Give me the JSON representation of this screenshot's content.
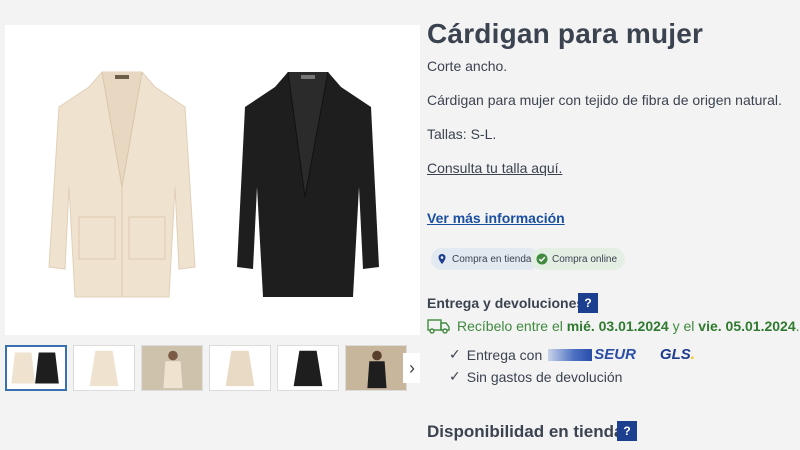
{
  "product": {
    "title": "Cárdigan para mujer",
    "cut": "Corte ancho.",
    "description": "Cárdigan para mujer con tejido de fibra de origen natural.",
    "sizes": "Tallas: S-L.",
    "size_link": "Consulta tu talla aquí.",
    "more_info": "Ver más información"
  },
  "badges": {
    "store": "Compra en tienda",
    "online": "Compra online"
  },
  "delivery": {
    "heading": "Entrega y devoluciones:",
    "help": "?",
    "prefix": "Recíbelo entre el",
    "date_from": "mié. 03.01.2024",
    "middle": "y el",
    "date_to": "vie. 05.01.2024",
    "suffix": ".",
    "shipping_label": "Entrega con",
    "carrier_1": "SEUR",
    "carrier_2": "GLS",
    "carrier_2_dot": ".",
    "returns": "Sin gastos de devolución",
    "check": "✓"
  },
  "availability": {
    "heading": "Disponibilidad en tienda",
    "help": "?"
  },
  "gallery": {
    "next": "›"
  },
  "colors": {
    "link": "#1a4fa0",
    "green": "#3f8a3f",
    "help_bg": "#1d3f8f",
    "beige": "#efe2cf",
    "black": "#1e1e1e"
  }
}
